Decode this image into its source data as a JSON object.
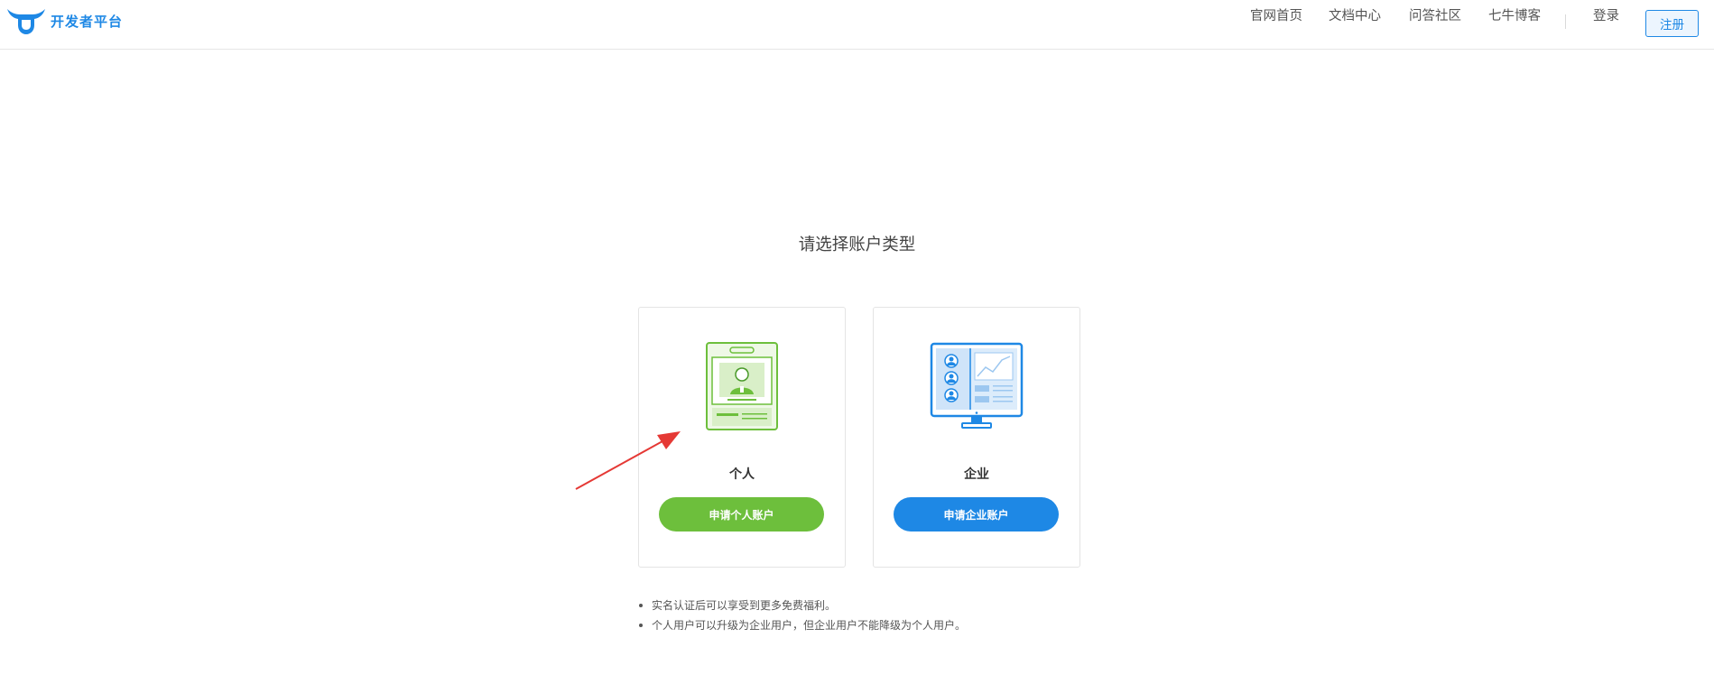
{
  "header": {
    "logo_text": "开发者平台",
    "nav": [
      {
        "label": "官网首页"
      },
      {
        "label": "文档中心"
      },
      {
        "label": "问答社区"
      },
      {
        "label": "七牛博客"
      }
    ],
    "login_label": "登录",
    "register_label": "注册"
  },
  "main": {
    "title": "请选择账户类型",
    "cards": [
      {
        "label": "个人",
        "button": "申请个人账户",
        "icon": "id-card-icon",
        "color": "#6dbf3c"
      },
      {
        "label": "企业",
        "button": "申请企业账户",
        "icon": "monitor-icon",
        "color": "#1e88e5"
      }
    ],
    "notes": [
      "实名认证后可以享受到更多免费福利。",
      "个人用户可以升级为企业用户，但企业用户不能降级为个人用户。"
    ]
  },
  "colors": {
    "accent_blue": "#1e88e5",
    "accent_green": "#6dbf3c",
    "annotation_arrow": "#e53935"
  }
}
